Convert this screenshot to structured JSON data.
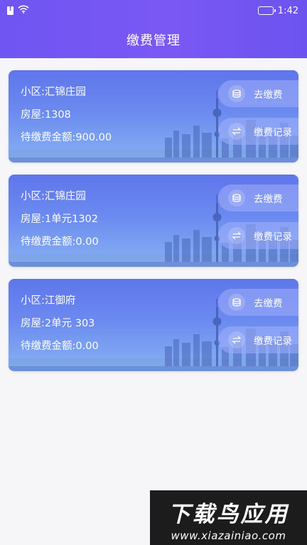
{
  "status_bar": {
    "time": "1:42"
  },
  "header": {
    "title": "缴费管理"
  },
  "cards": [
    {
      "community": "小区:汇锦庄园",
      "house": "房屋:1308",
      "amount": "待缴费金额:900.00",
      "pay_label": "去缴费",
      "record_label": "缴费记录"
    },
    {
      "community": "小区:汇锦庄园",
      "house": "房屋:1单元1302",
      "amount": "待缴费金额:0.00",
      "pay_label": "去缴费",
      "record_label": "缴费记录"
    },
    {
      "community": "小区:江御府",
      "house": "房屋:2单元 303",
      "amount": "待缴费金额:0.00",
      "pay_label": "去缴费",
      "record_label": "缴费记录"
    }
  ],
  "watermark": {
    "brand": "下载鸟应用",
    "url": "www.xiazainiao.com"
  },
  "colors": {
    "header": "#7058f3",
    "card": "#6b8af0",
    "background": "#f6f6f8"
  }
}
